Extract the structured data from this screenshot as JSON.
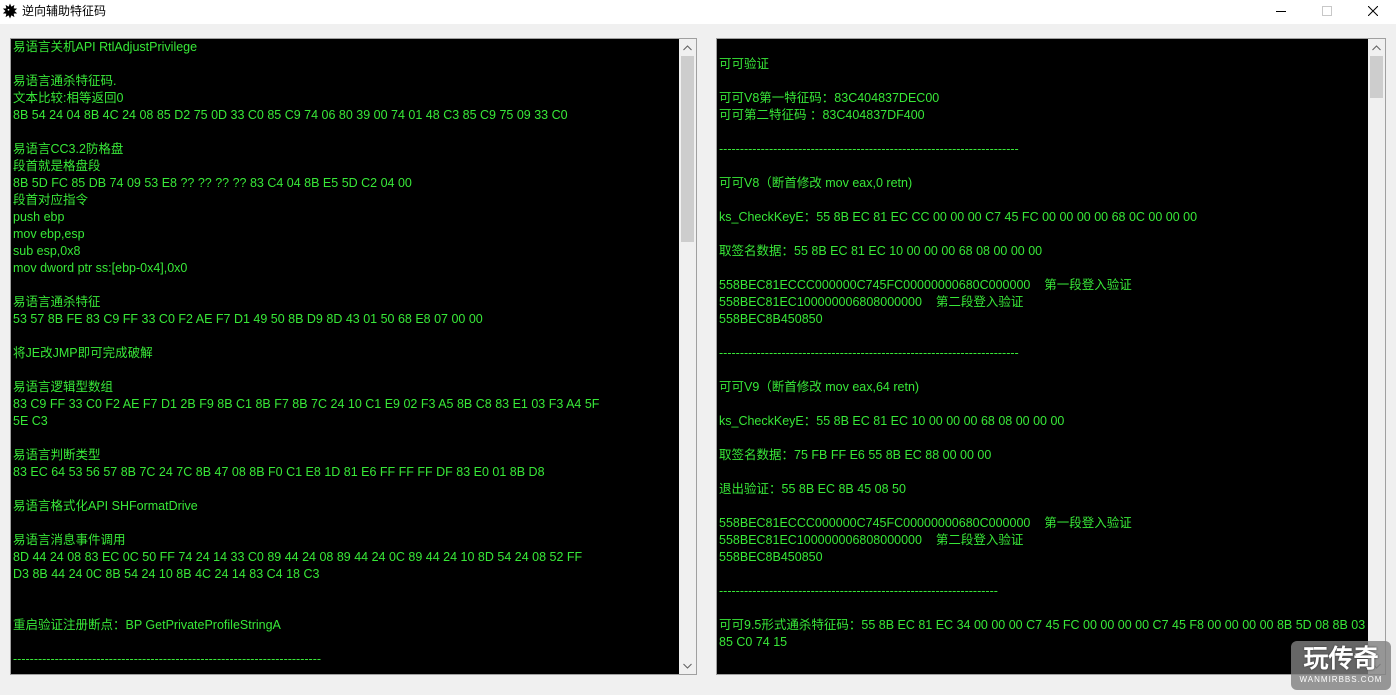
{
  "window": {
    "title": "逆向辅助特征码",
    "icon": "app-icon",
    "controls": {
      "minimize": {
        "icon": "minimize-icon",
        "enabled": true
      },
      "maximize": {
        "icon": "maximize-icon",
        "enabled": false
      },
      "close": {
        "icon": "close-icon",
        "enabled": true
      }
    }
  },
  "colors": {
    "window_background": "#f0f0f0",
    "titlebar_background": "#ffffff",
    "text_box_background": "#000000",
    "text": "#38e838",
    "scroll_thumb": "#cdcdcd",
    "disabled_icon": "#c8c8c8"
  },
  "left_panel": {
    "lines": [
      "易语言关机API RtlAdjustPrivilege",
      "",
      "易语言通杀特征码.",
      "文本比较:相等返回0",
      "8B 54 24 04 8B 4C 24 08 85 D2 75 0D 33 C0 85 C9 74 06 80 39 00 74 01 48 C3 85 C9 75 09 33 C0",
      "",
      "易语言CC3.2防格盘",
      "段首就是格盘段",
      "8B 5D FC 85 DB 74 09 53 E8 ?? ?? ?? ?? 83 C4 04 8B E5 5D C2 04 00",
      "段首对应指令",
      "push ebp",
      "mov ebp,esp",
      "sub esp,0x8",
      "mov dword ptr ss:[ebp-0x4],0x0",
      "",
      "易语言通杀特征",
      "53 57 8B FE 83 C9 FF 33 C0 F2 AE F7 D1 49 50 8B D9 8D 43 01 50 68 E8 07 00 00",
      "",
      "将JE改JMP即可完成破解",
      "",
      "易语言逻辑型数组",
      "83 C9 FF 33 C0 F2 AE F7 D1 2B F9 8B C1 8B F7 8B 7C 24 10 C1 E9 02 F3 A5 8B C8 83 E1 03 F3 A4 5F",
      "5E C3",
      "",
      "易语言判断类型",
      "83 EC 64 53 56 57 8B 7C 24 7C 8B 47 08 8B F0 C1 E8 1D 81 E6 FF FF FF DF 83 E0 01 8B D8",
      "",
      "易语言格式化API SHFormatDrive",
      "",
      "易语言消息事件调用",
      "8D 44 24 08 83 EC 0C 50 FF 74 24 14 33 C0 89 44 24 08 89 44 24 0C 89 44 24 10 8D 54 24 08 52 FF",
      "D3 8B 44 24 0C 8B 54 24 10 8B 4C 24 14 83 C4 18 C3",
      "",
      "",
      "重启验证注册断点：BP GetPrivateProfileStringA",
      "",
      "--------------------------------------------------------------------------"
    ],
    "scrollbar": {
      "thumb_fraction": 0.31,
      "position": 0
    }
  },
  "right_panel": {
    "lines": [
      "",
      "可可验证",
      "",
      "可可V8第一特征码：83C404837DEC00",
      "可可第二特征码 ：83C404837DF400",
      "",
      "------------------------------------------------------------------------",
      "",
      "可可V8（断首修改 mov eax,0 retn)",
      "",
      "ks_CheckKeyE：55 8B EC 81 EC CC 00 00 00 C7 45 FC 00 00 00 00 68 0C 00 00 00",
      "",
      "取签名数据：55 8B EC 81 EC 10 00 00 00 68 08 00 00 00",
      "",
      "558BEC81ECCC000000C745FC00000000680C000000    第一段登入验证",
      "558BEC81EC100000006808000000    第二段登入验证",
      "558BEC8B450850",
      "",
      "------------------------------------------------------------------------",
      "",
      "可可V9（断首修改 mov eax,64 retn)",
      "",
      "ks_CheckKeyE：55 8B EC 81 EC 10 00 00 00 68 08 00 00 00",
      "",
      "取签名数据：75 FB FF E6 55 8B EC 88 00 00 00",
      "",
      "退出验证：55 8B EC 8B 45 08 50",
      "",
      "558BEC81ECCC000000C745FC00000000680C000000    第一段登入验证",
      "558BEC81EC100000006808000000    第二段登入验证",
      "558BEC8B450850",
      "",
      "-------------------------------------------------------------------",
      "",
      "可可9.5形式通杀特征码：55 8B EC 81 EC 34 00 00 00 C7 45 FC 00 00 00 00 C7 45 F8 00 00 00 00 8B 5D 08 8B 03",
      "85 C0 74 15",
      ""
    ],
    "scrollbar": {
      "thumb_fraction": 0.07,
      "position": 0
    }
  },
  "watermark": {
    "text": "玩传奇",
    "subtext": "WANMIRBBS.COM"
  }
}
